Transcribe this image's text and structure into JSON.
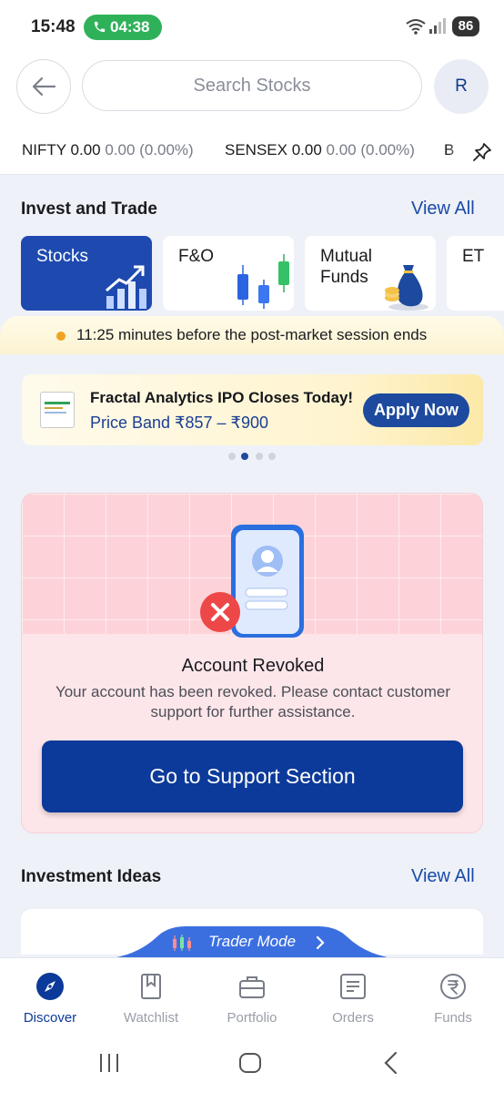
{
  "status_bar": {
    "time": "15:48",
    "call_timer": "04:38",
    "battery": "86"
  },
  "header": {
    "search_placeholder": "Search Stocks",
    "avatar_initial": "R"
  },
  "ticker": [
    {
      "name": "NIFTY",
      "value": "0.00",
      "change": "0.00 (0.00%)"
    },
    {
      "name": "SENSEX",
      "value": "0.00",
      "change": "0.00 (0.00%)"
    },
    {
      "name": "B",
      "value": "",
      "change": ""
    }
  ],
  "invest": {
    "title": "Invest and Trade",
    "view_all": "View All",
    "tiles": [
      {
        "label": "Stocks",
        "active": true
      },
      {
        "label": "F&O",
        "active": false
      },
      {
        "label": "Mutual\nFunds",
        "active": false
      },
      {
        "label": "ET",
        "active": false
      }
    ]
  },
  "session": {
    "time": "11:25",
    "text": "minutes before the post-market session ends"
  },
  "banner": {
    "title": "Fractal Analytics IPO Closes Today!",
    "subtitle": "Price Band ₹857 – ₹900",
    "button": "Apply Now",
    "carousel_count": 4,
    "carousel_active": 1
  },
  "revoked": {
    "title": "Account Revoked",
    "description": "Your account has been revoked. Please contact customer support for further assistance.",
    "button": "Go to Support Section"
  },
  "ideas": {
    "title": "Investment Ideas",
    "view_all": "View All"
  },
  "trader_mode": {
    "label": "Trader Mode"
  },
  "bottom_nav": [
    {
      "label": "Discover",
      "icon": "compass-icon",
      "active": true
    },
    {
      "label": "Watchlist",
      "icon": "bookmark-icon",
      "active": false
    },
    {
      "label": "Portfolio",
      "icon": "briefcase-icon",
      "active": false
    },
    {
      "label": "Orders",
      "icon": "orders-icon",
      "active": false
    },
    {
      "label": "Funds",
      "icon": "rupee-icon",
      "active": false
    }
  ],
  "colors": {
    "brand": "#0c3a9a",
    "accent_link": "#1a4aa8",
    "call_green": "#2fb15a",
    "warning_dot": "#f0a321",
    "card_bg": "#fde6ea",
    "error_red": "#ee4747"
  }
}
